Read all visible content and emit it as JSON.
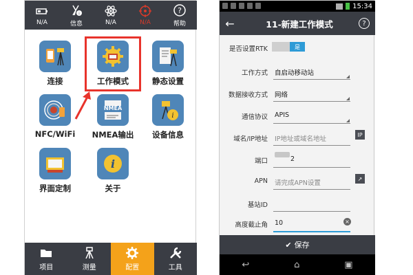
{
  "left": {
    "top_bar": [
      {
        "label": "N/A",
        "icon": "device-icon"
      },
      {
        "label": "信息",
        "icon": "info-tower-icon"
      },
      {
        "label": "N/A",
        "icon": "atom-icon"
      },
      {
        "label": "N/A",
        "icon": "crosshair-icon"
      },
      {
        "label": "帮助",
        "icon": "help-icon"
      }
    ],
    "apps": [
      {
        "label": "连接"
      },
      {
        "label": "工作模式"
      },
      {
        "label": "静态设置"
      },
      {
        "label": "NFC/WiFi"
      },
      {
        "label": "NMEA输出",
        "icon_text": "NMEA"
      },
      {
        "label": "设备信息"
      },
      {
        "label": "界面定制"
      },
      {
        "label": "关于"
      }
    ],
    "bottom_bar": [
      {
        "label": "项目"
      },
      {
        "label": "测量"
      },
      {
        "label": "配置"
      },
      {
        "label": "工具"
      }
    ]
  },
  "right": {
    "status_time": "15:34",
    "title": "11-新建工作模式",
    "help": "?",
    "fields": [
      {
        "label": "是否设置RTK",
        "toggle": "是"
      },
      {
        "label": "工作方式",
        "value": "自启动移动站"
      },
      {
        "label": "数据接收方式",
        "value": "网络"
      },
      {
        "label": "通信协议",
        "value": "APIS"
      },
      {
        "label": "域名/IP地址",
        "placeholder": "IP地址或域名地址",
        "button": "IP"
      },
      {
        "label": "端口",
        "value": "2"
      },
      {
        "label": "APN",
        "placeholder": "请完成APN设置",
        "button": "↗"
      },
      {
        "label": "基站ID",
        "value": ""
      },
      {
        "label": "高度截止角",
        "value": "10"
      }
    ],
    "save_label": "保存"
  }
}
